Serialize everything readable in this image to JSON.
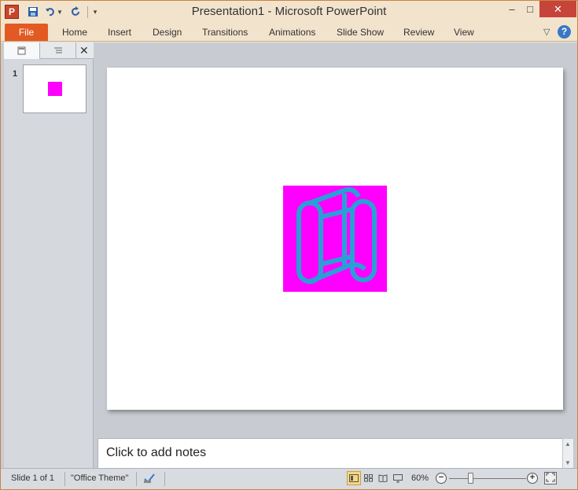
{
  "app": {
    "icon_letter": "P",
    "title": "Presentation1  -  Microsoft PowerPoint"
  },
  "quick_access": {
    "save_icon": "save-icon",
    "undo_icon": "undo-icon",
    "redo_icon": "redo-icon",
    "customize_icon": "customize-qat-icon"
  },
  "window_controls": {
    "minimize": "–",
    "maximize": "□",
    "close": "✕"
  },
  "ribbon": {
    "file_label": "File",
    "tabs": [
      "Home",
      "Insert",
      "Design",
      "Transitions",
      "Animations",
      "Slide Show",
      "Review",
      "View"
    ],
    "collapse_glyph": "▽",
    "help_glyph": "?"
  },
  "left_pane": {
    "close_glyph": "✕",
    "slide_number": "1"
  },
  "slide": {
    "image_background": "#ff00ff",
    "image_stroke": "#2a9fd6"
  },
  "notes": {
    "placeholder": "Click to add notes"
  },
  "status": {
    "slide_info": "Slide 1 of 1",
    "theme": "\"Office Theme\"",
    "zoom": "60%",
    "zoom_minus": "−",
    "zoom_plus": "+"
  },
  "colors": {
    "file_tab": "#e25a22",
    "close_button": "#c7443a",
    "accent_blue": "#3a78c4"
  }
}
